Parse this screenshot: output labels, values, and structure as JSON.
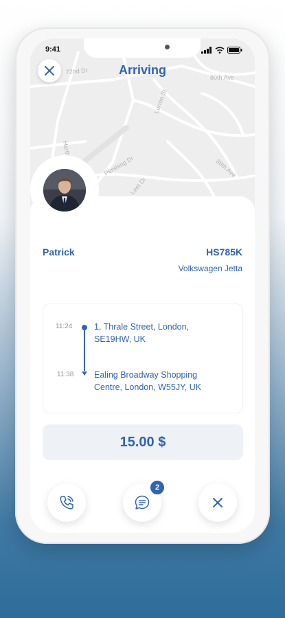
{
  "status_bar": {
    "time": "9:41"
  },
  "header": {
    "title": "Arriving"
  },
  "map": {
    "street_labels": [
      "72nd Dr",
      "80th Ave",
      "Lorma St",
      "Harth St",
      "Pershing Dr",
      "Leet Dr",
      "88th Ave"
    ]
  },
  "driver": {
    "name": "Patrick",
    "plate": "HS785K",
    "car": "Volkswagen Jetta"
  },
  "route": {
    "pickup": {
      "time": "11:24",
      "address": "1, Thrale Street, London, SE19HW, UK"
    },
    "dropoff": {
      "time": "11:38",
      "address": "Ealing Broadway Shopping Centre, London, W55JY, UK"
    }
  },
  "fare": {
    "price": "15.00 $"
  },
  "actions": {
    "chat_badge": "2"
  },
  "colors": {
    "accent": "#2f63b3",
    "background_top": "#ffffff",
    "background_bottom": "#2f6c9a"
  }
}
